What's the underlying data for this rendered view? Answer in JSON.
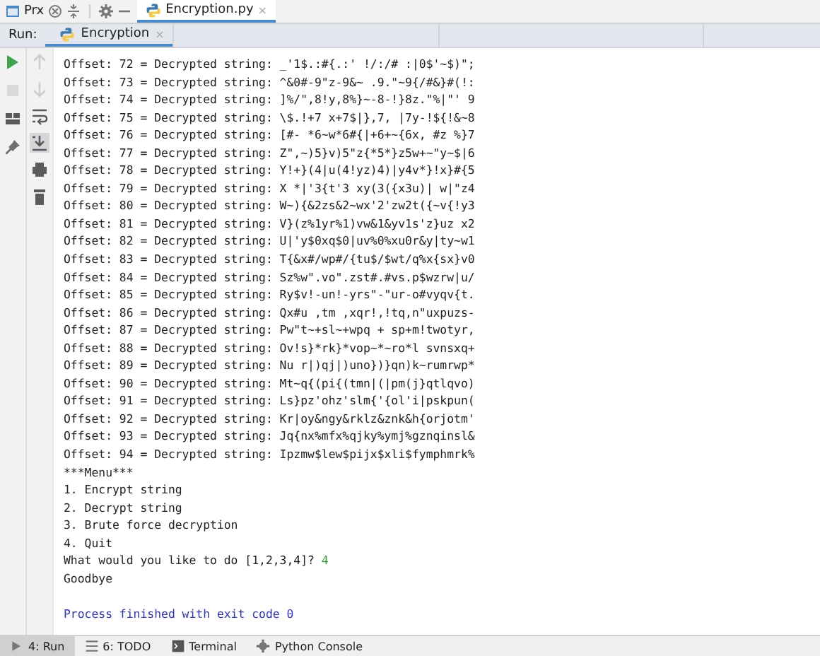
{
  "top_bar": {
    "project_label": "Prx",
    "file_tab": {
      "label": "Encryption.py",
      "close": "×",
      "selected": true
    }
  },
  "run_bar": {
    "label": "Run:",
    "tab": {
      "label": "Encryption",
      "close": "×",
      "selected": true
    }
  },
  "left_tools": [
    {
      "kind": "run",
      "disabled": false
    },
    {
      "kind": "stop",
      "disabled": true
    },
    {
      "kind": "layout",
      "disabled": false
    },
    {
      "kind": "pin",
      "disabled": false
    }
  ],
  "right_tools": [
    {
      "kind": "up",
      "disabled": true,
      "selected": false
    },
    {
      "kind": "down",
      "disabled": true,
      "selected": false
    },
    {
      "kind": "wrap",
      "disabled": false,
      "selected": false
    },
    {
      "kind": "scroll",
      "disabled": false,
      "selected": true
    },
    {
      "kind": "print",
      "disabled": false,
      "selected": false
    },
    {
      "kind": "trash",
      "disabled": false,
      "selected": false
    }
  ],
  "console": [
    {
      "kind": "out",
      "text": "Offset: 72 = Decrypted string: _'1$.:#{.:' !/:/# :|0$'~$)\";"
    },
    {
      "kind": "out",
      "text": "Offset: 73 = Decrypted string: ^&0#-9\"z-9&~ .9.\"~9{/#&}#(!:"
    },
    {
      "kind": "out",
      "text": "Offset: 74 = Decrypted string: ]%/\",8!y,8%}~-8-!}8z.\"%|\"' 9"
    },
    {
      "kind": "out",
      "text": "Offset: 75 = Decrypted string: \\$.!+7 x+7$|},7, |7y-!${!&~8"
    },
    {
      "kind": "out",
      "text": "Offset: 76 = Decrypted string: [#- *6~w*6#{|+6+~{6x, #z %}7"
    },
    {
      "kind": "out",
      "text": "Offset: 77 = Decrypted string: Z\",~)5}v)5\"z{*5*}z5w+~\"y~$|6"
    },
    {
      "kind": "out",
      "text": "Offset: 78 = Decrypted string: Y!+}(4|u(4!yz)4)|y4v*}!x}#{5"
    },
    {
      "kind": "out",
      "text": "Offset: 79 = Decrypted string: X *|'3{t'3 xy(3({x3u)| w|\"z4"
    },
    {
      "kind": "out",
      "text": "Offset: 80 = Decrypted string: W~){&2zs&2~wx'2'zw2t({~v{!y3"
    },
    {
      "kind": "out",
      "text": "Offset: 81 = Decrypted string: V}(z%1yr%1)vw&1&yv1s'z}uz x2"
    },
    {
      "kind": "out",
      "text": "Offset: 82 = Decrypted string: U|'y$0xq$0|uv%0%xu0r&y|ty~w1"
    },
    {
      "kind": "out",
      "text": "Offset: 83 = Decrypted string: T{&x#/wp#/{tu$/$wt/q%x{sx}v0"
    },
    {
      "kind": "out",
      "text": "Offset: 84 = Decrypted string: Sz%w\".vo\".zst#.#vs.p$wzrw|u/"
    },
    {
      "kind": "out",
      "text": "Offset: 85 = Decrypted string: Ry$v!-un!-yrs\"-\"ur-o#vyqv{t."
    },
    {
      "kind": "out",
      "text": "Offset: 86 = Decrypted string: Qx#u ,tm ,xqr!,!tq,n\"uxpuzs-"
    },
    {
      "kind": "out",
      "text": "Offset: 87 = Decrypted string: Pw\"t~+sl~+wpq + sp+m!twotyr,"
    },
    {
      "kind": "out",
      "text": "Offset: 88 = Decrypted string: Ov!s}*rk}*vop~*~ro*l svnsxq+"
    },
    {
      "kind": "out",
      "text": "Offset: 89 = Decrypted string: Nu r|)qj|)uno})}qn)k~rumrwp*"
    },
    {
      "kind": "out",
      "text": "Offset: 90 = Decrypted string: Mt~q{(pi{(tmn|(|pm(j}qtlqvo)"
    },
    {
      "kind": "out",
      "text": "Offset: 91 = Decrypted string: Ls}pz'ohz'slm{'{ol'i|pskpun("
    },
    {
      "kind": "out",
      "text": "Offset: 92 = Decrypted string: Kr|oy&ngy&rklz&znk&h{orjotm'"
    },
    {
      "kind": "out",
      "text": "Offset: 93 = Decrypted string: Jq{nx%mfx%qjky%ymj%gznqinsl&"
    },
    {
      "kind": "out",
      "text": "Offset: 94 = Decrypted string: Ipzmw$lew$pijx$xli$fymphmrk%"
    },
    {
      "kind": "out",
      "text": "***Menu***"
    },
    {
      "kind": "out",
      "text": "1. Encrypt string"
    },
    {
      "kind": "out",
      "text": "2. Decrypt string"
    },
    {
      "kind": "out",
      "text": "3. Brute force decryption"
    },
    {
      "kind": "out",
      "text": "4. Quit"
    },
    {
      "kind": "prompt",
      "text": "What would you like to do [1,2,3,4]?",
      "input": "4"
    },
    {
      "kind": "out",
      "text": "Goodbye"
    },
    {
      "kind": "blank"
    },
    {
      "kind": "exit",
      "text": "Process finished with exit code 0"
    }
  ],
  "bottom_tabs": [
    {
      "kind": "run",
      "label": "4: Run",
      "selected": true
    },
    {
      "kind": "todo",
      "label": "6: TODO",
      "selected": false
    },
    {
      "kind": "terminal",
      "label": "Terminal",
      "selected": false
    },
    {
      "kind": "python",
      "label": "Python Console",
      "selected": false
    }
  ]
}
